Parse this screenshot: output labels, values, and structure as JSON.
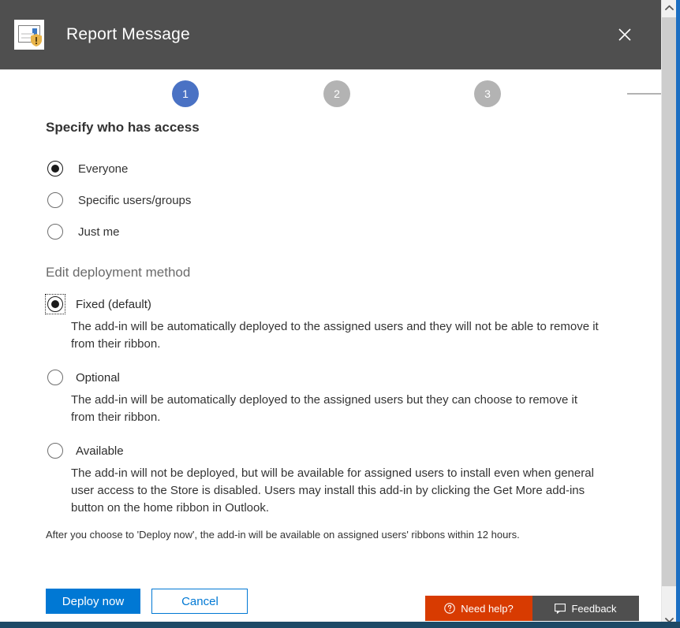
{
  "header": {
    "title": "Report Message",
    "icon": "report-message-addin-icon",
    "close_icon": "close-icon",
    "background": "#4f4f4f"
  },
  "steps": {
    "items": [
      {
        "number": "1",
        "state": "active"
      },
      {
        "number": "2",
        "state": "inactive"
      },
      {
        "number": "3",
        "state": "inactive"
      }
    ],
    "active_color": "#4a72c4",
    "inactive_color": "#b3b3b3"
  },
  "access": {
    "title": "Specify who has access",
    "options": [
      {
        "label": "Everyone",
        "checked": true
      },
      {
        "label": "Specific users/groups",
        "checked": false
      },
      {
        "label": "Just me",
        "checked": false
      }
    ]
  },
  "deployment": {
    "title": "Edit deployment method",
    "options": [
      {
        "label": "Fixed (default)",
        "checked": true,
        "focused": true,
        "description": "The add-in will be automatically deployed to the assigned users and they will not be able to remove it from their ribbon."
      },
      {
        "label": "Optional",
        "checked": false,
        "focused": false,
        "description": "The add-in will be automatically deployed to the assigned users but they can choose to remove it from their ribbon."
      },
      {
        "label": "Available",
        "checked": false,
        "focused": false,
        "description": "The add-in will not be deployed, but will be available for assigned users to install even when general user access to the Store is disabled. Users may install this add-in by clicking the Get More add-ins button on the home ribbon in Outlook."
      }
    ],
    "footnote": "After you choose to 'Deploy now', the add-in will be available on assigned users' ribbons within 12 hours."
  },
  "actions": {
    "primary_label": "Deploy now",
    "secondary_label": "Cancel",
    "primary_color": "#0078d4"
  },
  "dock": {
    "help_label": "Need help?",
    "help_icon": "question-circle-icon",
    "help_color": "#d83b01",
    "feedback_label": "Feedback",
    "feedback_icon": "speech-bubble-icon",
    "feedback_color": "#4f4f4f"
  },
  "scrollbar": {
    "up_icon": "chevron-up-icon",
    "down_icon": "chevron-down-icon",
    "thumb_color": "#cdcdcd"
  }
}
